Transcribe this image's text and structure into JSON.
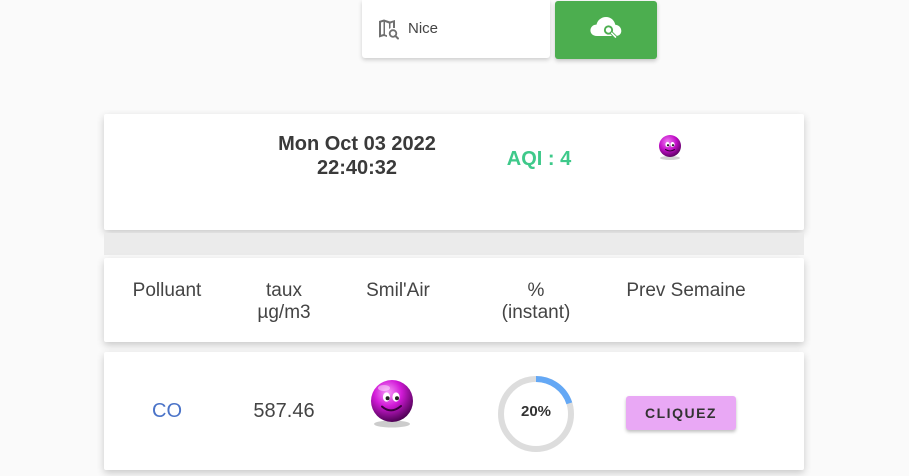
{
  "search": {
    "value": "Nice",
    "icon": "map-search-icon",
    "button_icon": "cloud-search-icon",
    "button_color": "#4cae4f"
  },
  "summary": {
    "date_line1": "Mon Oct 03 2022",
    "date_line2": "22:40:32",
    "aqi_label": "AQI : 4",
    "aqi_color": "#3ec98a",
    "smiley_icon": "purple-smiley-icon"
  },
  "table": {
    "headers": [
      {
        "line1": "Polluant",
        "line2": ""
      },
      {
        "line1": "taux",
        "line2": "µg/m3"
      },
      {
        "line1": "Smil'Air",
        "line2": ""
      },
      {
        "line1": "%",
        "line2": "(instant)"
      },
      {
        "line1": "Prev Semaine",
        "line2": ""
      }
    ],
    "rows": [
      {
        "pollutant": "CO",
        "value": "587.46",
        "smiley_icon": "purple-smiley-icon",
        "percent_label": "20%",
        "percent": 20,
        "button_label": "CLIQUEZ"
      }
    ]
  },
  "colors": {
    "smiley": "#c20fc8",
    "gauge_fill": "#64a8f5",
    "gauge_track": "#dddddd",
    "button_bg": "#e9a8f5",
    "pollutant_link": "#4a73c8"
  }
}
